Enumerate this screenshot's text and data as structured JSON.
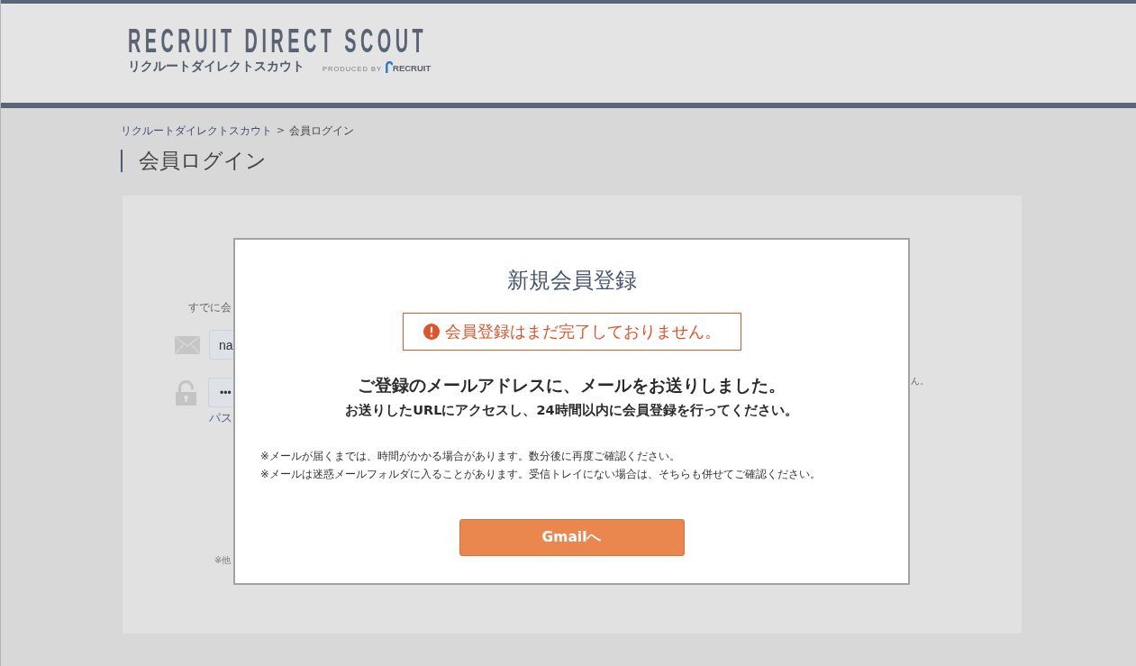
{
  "header": {
    "logo_title": "RECRUIT DIRECT SCOUT",
    "logo_subtitle": "リクルートダイレクトスカウト",
    "produced_by": "PRODUCED BY",
    "company": "RECRUIT"
  },
  "breadcrumb": {
    "items": [
      {
        "label": "リクルートダイレクトスカウト",
        "current": false
      },
      {
        "label": "会員ログイン",
        "current": true
      }
    ],
    "separator": ">"
  },
  "page_title": "会員ログイン",
  "login_form": {
    "intro": "すでに会",
    "email_field": {
      "value": "na"
    },
    "password_field": {
      "value": "•••"
    },
    "link": "パス",
    "note": "※他",
    "side_text": "ん。"
  },
  "modal": {
    "title": "新規会員登録",
    "alert": "会員登録はまだ完了しておりません。",
    "message": "ご登録のメールアドレスに、メールをお送りしました。",
    "instruction": "お送りしたURLにアクセスし、24時間以内に会員登録を行ってください。",
    "notes": [
      "※メールが届くまでは、時間がかかる場合があります。数分後に再度ご確認ください。",
      "※メールは迷惑メールフォルダに入ることがあります。受信トレイにない場合は、そちらも併せてご確認ください。"
    ],
    "button": "Gmailへ"
  }
}
